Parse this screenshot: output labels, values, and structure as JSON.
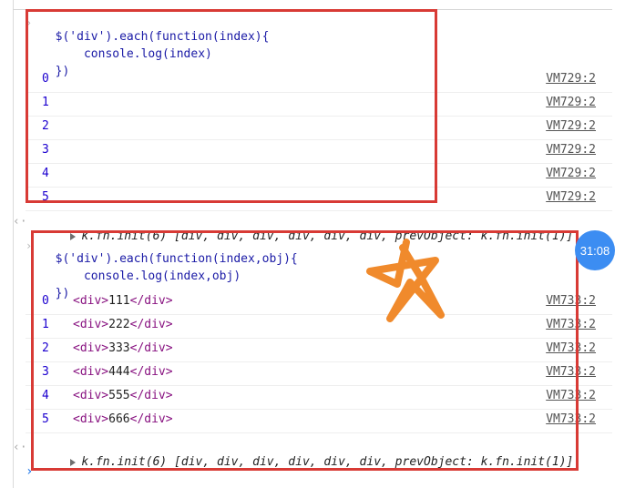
{
  "block1": {
    "code": [
      "$('div').each(function(index){",
      "    console.log(index)",
      "})"
    ],
    "rows": [
      {
        "index": "0",
        "source": "VM729:2"
      },
      {
        "index": "1",
        "source": "VM729:2"
      },
      {
        "index": "2",
        "source": "VM729:2"
      },
      {
        "index": "3",
        "source": "VM729:2"
      },
      {
        "index": "4",
        "source": "VM729:2"
      },
      {
        "index": "5",
        "source": "VM729:2"
      }
    ],
    "result": "k.fn.init(6) [div, div, div, div, div, div, prevObject: k.fn.init(1)]"
  },
  "block2": {
    "code": [
      "$('div').each(function(index,obj){",
      "    console.log(index,obj)",
      "})"
    ],
    "rows": [
      {
        "index": "0",
        "node_open": "<div>",
        "node_text": "111",
        "node_close": "</div>",
        "source": "VM733:2"
      },
      {
        "index": "1",
        "node_open": "<div>",
        "node_text": "222",
        "node_close": "</div>",
        "source": "VM733:2"
      },
      {
        "index": "2",
        "node_open": "<div>",
        "node_text": "333",
        "node_close": "</div>",
        "source": "VM733:2"
      },
      {
        "index": "3",
        "node_open": "<div>",
        "node_text": "444",
        "node_close": "</div>",
        "source": "VM733:2"
      },
      {
        "index": "4",
        "node_open": "<div>",
        "node_text": "555",
        "node_close": "</div>",
        "source": "VM733:2"
      },
      {
        "index": "5",
        "node_open": "<div>",
        "node_text": "666",
        "node_close": "</div>",
        "source": "VM733:2"
      }
    ],
    "result": "k.fn.init(6) [div, div, div, div, div, div, prevObject: k.fn.init(1)]"
  },
  "timer_badge": "31:08",
  "icons": {
    "prompt": "chevron-right-icon",
    "expand": "triangle-right-icon",
    "return": "return-arrow-icon",
    "annotation": "hand-drawn-star-icon"
  },
  "colors": {
    "highlight_box": "#d83a35",
    "star": "#f08a2c",
    "timer": "#3c8df2",
    "string": "#c41a16",
    "keyword": "#aa0d91",
    "number": "#1c00cf"
  }
}
